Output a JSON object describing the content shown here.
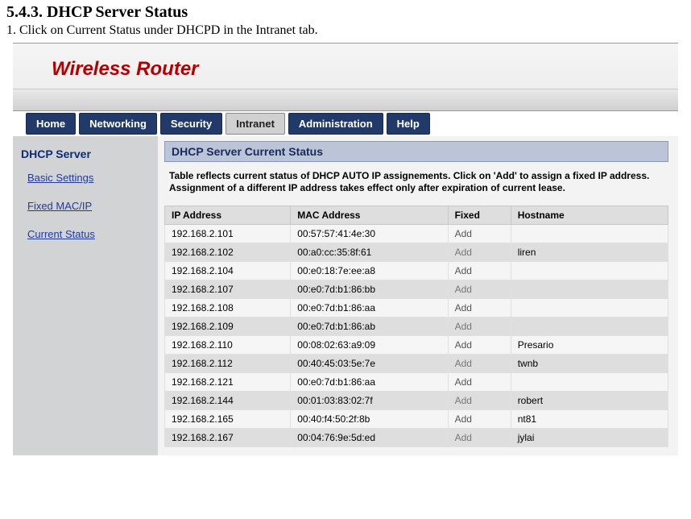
{
  "doc": {
    "heading": "5.4.3. DHCP Server Status",
    "instruction": "1. Click on Current Status under DHCPD in the Intranet tab."
  },
  "banner": {
    "title": "Wireless Router"
  },
  "tabs": [
    {
      "label": "Home",
      "active": false
    },
    {
      "label": "Networking",
      "active": false
    },
    {
      "label": "Security",
      "active": false
    },
    {
      "label": "Intranet",
      "active": true
    },
    {
      "label": "Administration",
      "active": false
    },
    {
      "label": "Help",
      "active": false
    }
  ],
  "sidebar": {
    "heading": "DHCP Server",
    "links": [
      {
        "label": "Basic Settings"
      },
      {
        "label": "Fixed MAC/IP"
      },
      {
        "label": "Current Status"
      }
    ]
  },
  "panel": {
    "title": "DHCP Server Current Status",
    "description": "Table reflects current status of DHCP AUTO IP assignements. Click on 'Add' to assign a fixed IP address. Assignment of a different IP address takes effect only after expiration of current lease."
  },
  "table": {
    "headers": {
      "ip": "IP Address",
      "mac": "MAC Address",
      "fixed": "Fixed",
      "host": "Hostname"
    },
    "add_label": "Add",
    "rows": [
      {
        "ip": "192.168.2.101",
        "mac": "00:57:57:41:4e:30",
        "host": ""
      },
      {
        "ip": "192.168.2.102",
        "mac": "00:a0:cc:35:8f:61",
        "host": "liren"
      },
      {
        "ip": "192.168.2.104",
        "mac": "00:e0:18:7e:ee:a8",
        "host": ""
      },
      {
        "ip": "192.168.2.107",
        "mac": "00:e0:7d:b1:86:bb",
        "host": ""
      },
      {
        "ip": "192.168.2.108",
        "mac": "00:e0:7d:b1:86:aa",
        "host": ""
      },
      {
        "ip": "192.168.2.109",
        "mac": "00:e0:7d:b1:86:ab",
        "host": ""
      },
      {
        "ip": "192.168.2.110",
        "mac": "00:08:02:63:a9:09",
        "host": "Presario"
      },
      {
        "ip": "192.168.2.112",
        "mac": "00:40:45:03:5e:7e",
        "host": "twnb"
      },
      {
        "ip": "192.168.2.121",
        "mac": "00:e0:7d:b1:86:aa",
        "host": ""
      },
      {
        "ip": "192.168.2.144",
        "mac": "00:01:03:83:02:7f",
        "host": "robert"
      },
      {
        "ip": "192.168.2.165",
        "mac": "00:40:f4:50:2f:8b",
        "host": "nt81"
      },
      {
        "ip": "192.168.2.167",
        "mac": "00:04:76:9e:5d:ed",
        "host": "jylai"
      }
    ]
  }
}
